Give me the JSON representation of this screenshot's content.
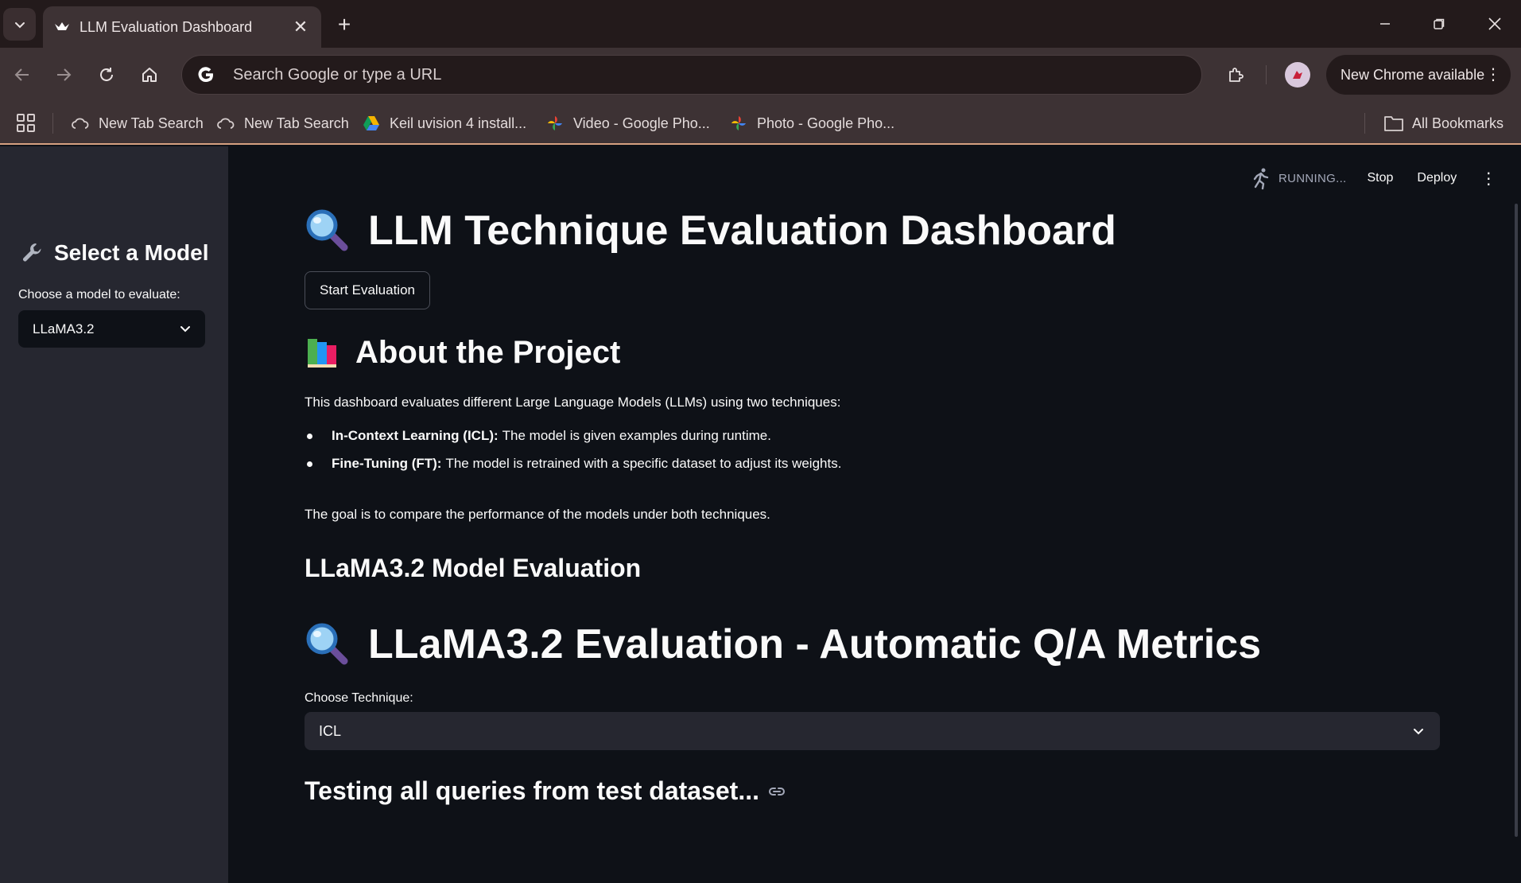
{
  "browser": {
    "tab_title": "LLM Evaluation Dashboard",
    "omnibox_placeholder": "Search Google or type a URL",
    "update_label": "New Chrome available",
    "bookmarks": [
      {
        "label": "New Tab Search",
        "icon": "cloud-icon"
      },
      {
        "label": "New Tab Search",
        "icon": "cloud-icon"
      },
      {
        "label": "Keil uvision 4 install...",
        "icon": "drive-icon"
      },
      {
        "label": "Video - Google Pho...",
        "icon": "photos-icon"
      },
      {
        "label": "Photo - Google Pho...",
        "icon": "photos-icon"
      }
    ],
    "all_bookmarks_label": "All Bookmarks"
  },
  "header": {
    "status": "RUNNING...",
    "stop_label": "Stop",
    "deploy_label": "Deploy"
  },
  "sidebar": {
    "title": "Select a Model",
    "select_label": "Choose a model to evaluate:",
    "selected_model": "LLaMA3.2"
  },
  "main": {
    "title": "LLM Technique Evaluation Dashboard",
    "start_button": "Start Evaluation",
    "about_heading": "About the Project",
    "intro": "This dashboard evaluates different Large Language Models (LLMs) using two techniques:",
    "bullets": [
      {
        "term": "In-Context Learning (ICL):",
        "text": "The model is given examples during runtime."
      },
      {
        "term": "Fine-Tuning (FT):",
        "text": "The model is retrained with a specific dataset to adjust its weights."
      }
    ],
    "goal": "The goal is to compare the performance of the models under both techniques.",
    "model_eval_heading": "LLaMA3.2 Model Evaluation",
    "metrics_heading": "LLaMA3.2 Evaluation - Automatic Q/A Metrics",
    "technique_label": "Choose Technique:",
    "technique_value": "ICL",
    "testing_heading": "Testing all queries from test dataset..."
  }
}
